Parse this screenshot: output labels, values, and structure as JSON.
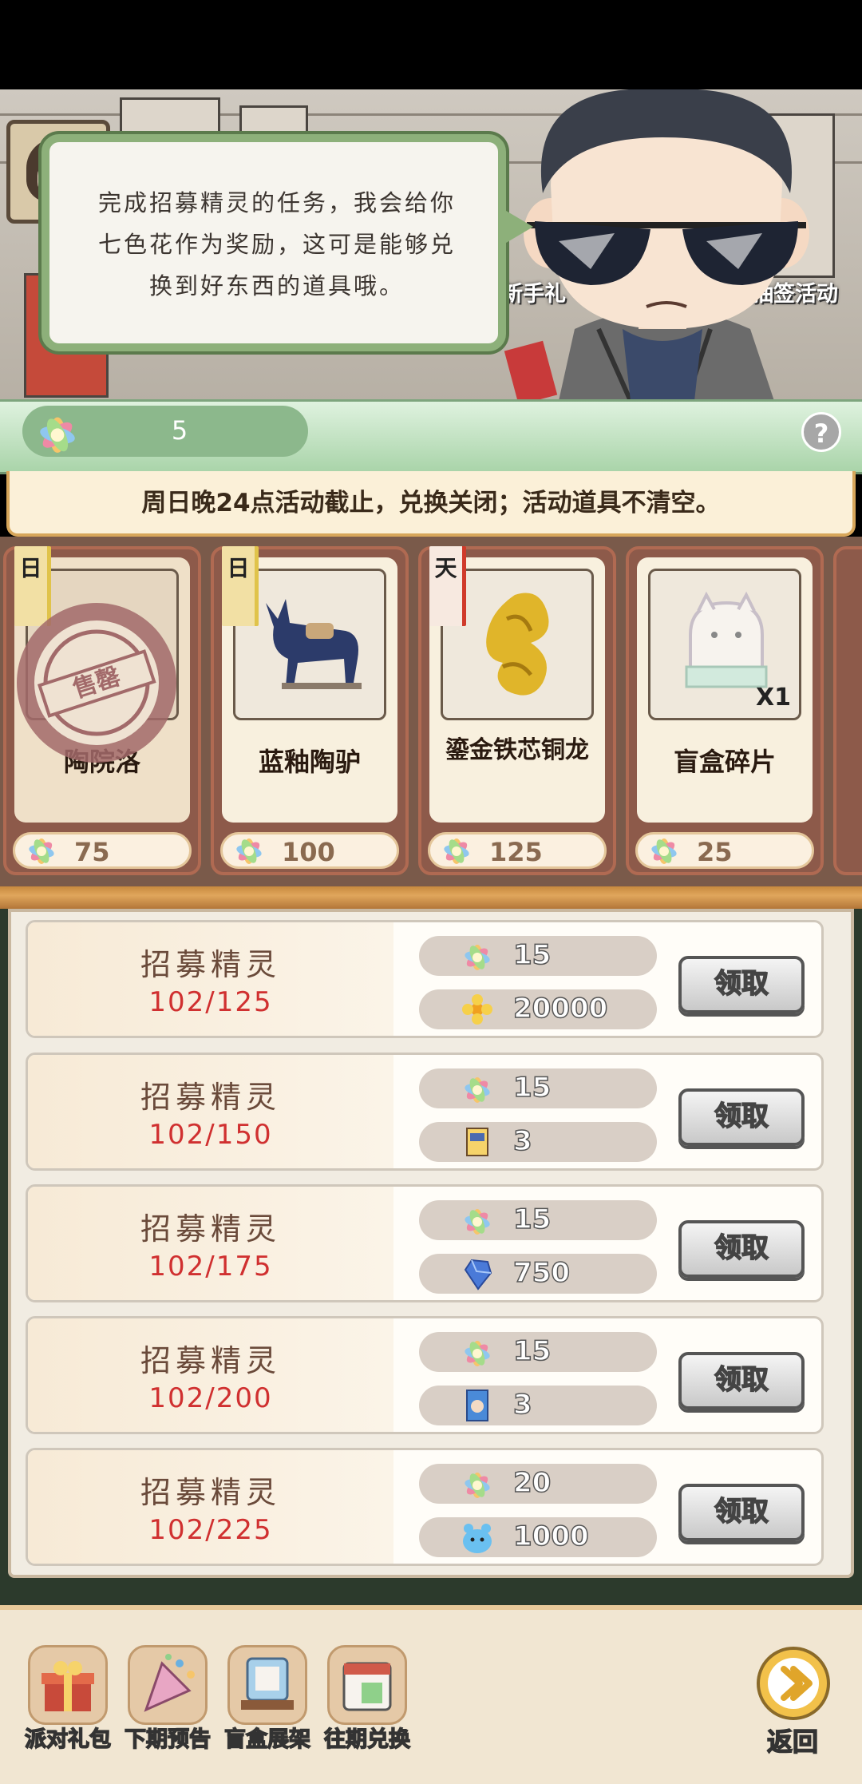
{
  "bubble_lines": [
    "完成招募精灵的任务，我会给你",
    "七色花作为奖励，这可是能够兑",
    "换到好东西的道具哦。"
  ],
  "scene_labels": {
    "left": "新手礼",
    "right": "抽签活动"
  },
  "currency": {
    "value": "5",
    "help": "?"
  },
  "notice": "周日晚24点活动截止，兑换关闭；活动道具不清空。",
  "shop_items": [
    {
      "name": "陶院洛",
      "price": "75",
      "tag": "日",
      "sold_out_stamp": "售罄"
    },
    {
      "name": "蓝釉陶驴",
      "price": "100",
      "tag": "日"
    },
    {
      "name": "鎏金铁芯铜龙",
      "price": "125",
      "tag": "天"
    },
    {
      "name": "盲盒碎片",
      "price": "25",
      "qty": "X1"
    }
  ],
  "tasks": [
    {
      "title": "招募精灵",
      "progress": "102/125",
      "reward1": "15",
      "reward2": "20000",
      "reward2_icon": "flower-coin-icon",
      "button": "领取"
    },
    {
      "title": "招募精灵",
      "progress": "102/150",
      "reward1": "15",
      "reward2": "3",
      "reward2_icon": "ticket-box-icon",
      "button": "领取"
    },
    {
      "title": "招募精灵",
      "progress": "102/175",
      "reward1": "15",
      "reward2": "750",
      "reward2_icon": "blue-gem-icon",
      "button": "领取"
    },
    {
      "title": "招募精灵",
      "progress": "102/200",
      "reward1": "15",
      "reward2": "3",
      "reward2_icon": "card-pack-icon",
      "button": "领取"
    },
    {
      "title": "招募精灵",
      "progress": "102/225",
      "reward1": "20",
      "reward2": "1000",
      "reward2_icon": "blue-creature-icon",
      "button": "领取"
    }
  ],
  "bottom_nav": [
    {
      "label": "派对礼包",
      "icon": "gift-pack-icon"
    },
    {
      "label": "下期预告",
      "icon": "party-popper-icon"
    },
    {
      "label": "盲盒展架",
      "icon": "display-shelf-icon"
    },
    {
      "label": "往期兑换",
      "icon": "calendar-exchange-icon"
    }
  ],
  "back_label": "返回",
  "colors": {
    "accent_green": "#8db07a",
    "progress_red": "#d03030",
    "wood": "#c7893e"
  }
}
